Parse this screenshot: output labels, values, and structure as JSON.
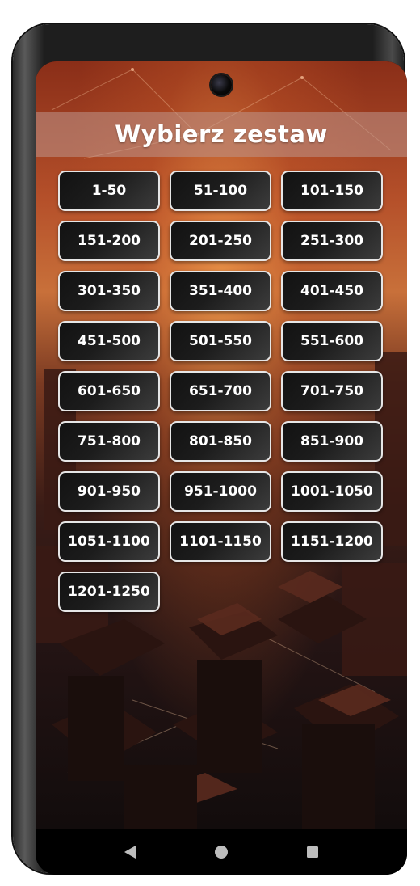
{
  "screen": {
    "title": "Wybierz zestaw"
  },
  "sets": [
    "1-50",
    "51-100",
    "101-150",
    "151-200",
    "201-250",
    "251-300",
    "301-350",
    "351-400",
    "401-450",
    "451-500",
    "501-550",
    "551-600",
    "601-650",
    "651-700",
    "701-750",
    "751-800",
    "801-850",
    "851-900",
    "901-950",
    "951-1000",
    "1001-1050",
    "1051-1100",
    "1101-1150",
    "1151-1200",
    "1201-1250"
  ],
  "nav": {
    "back_icon": "back-triangle-icon",
    "home_icon": "home-circle-icon",
    "recents_icon": "recents-square-icon"
  },
  "colors": {
    "button_border": "#e6e6e6",
    "button_bg": "#1c1c1c",
    "title_bar_bg": "#be968c"
  }
}
